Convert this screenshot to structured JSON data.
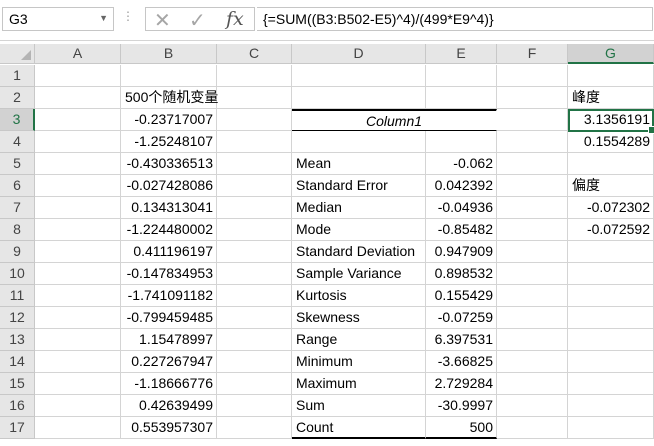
{
  "name_box": {
    "value": "G3"
  },
  "formula_bar": {
    "formula": "{=SUM((B3:B502-E5)^4)/(499*E9^4)}",
    "fx_label": "fx"
  },
  "columns": [
    "A",
    "B",
    "C",
    "D",
    "E",
    "F",
    "G"
  ],
  "rows": [
    "1",
    "2",
    "3",
    "4",
    "5",
    "6",
    "7",
    "8",
    "9",
    "10",
    "11",
    "12",
    "13",
    "14",
    "15",
    "16",
    "17"
  ],
  "cells": {
    "B2": "500个随机变量",
    "B3": "-0.23717007",
    "B4": "-1.25248107",
    "B5": "-0.430336513",
    "B6": "-0.027428086",
    "B7": "0.134313041",
    "B8": "-1.224480002",
    "B9": "0.411196197",
    "B10": "-0.147834953",
    "B11": "-1.741091182",
    "B12": "-0.799459485",
    "B13": "1.15478997",
    "B14": "0.227267947",
    "B15": "-1.18666776",
    "B16": "0.42639499",
    "B17": "0.553957307",
    "D3": "Column1",
    "D5": "Mean",
    "D6": "Standard Error",
    "D7": "Median",
    "D8": "Mode",
    "D9": "Standard Deviation",
    "D10": "Sample Variance",
    "D11": "Kurtosis",
    "D12": "Skewness",
    "D13": "Range",
    "D14": "Minimum",
    "D15": "Maximum",
    "D16": "Sum",
    "D17": "Count",
    "E5": "-0.062",
    "E6": "0.042392",
    "E7": "-0.04936",
    "E8": "-0.85482",
    "E9": "0.947909",
    "E10": "0.898532",
    "E11": "0.155429",
    "E12": "-0.07259",
    "E13": "6.397531",
    "E14": "-3.66825",
    "E15": "2.729284",
    "E16": "-30.9997",
    "E17": "500",
    "G2": "峰度",
    "G3": "3.1356191",
    "G4": "0.1554289",
    "G6": "偏度",
    "G7": "-0.072302",
    "G8": "-0.072592"
  },
  "colors": {
    "accent": "#217346",
    "header_bg": "#e6e6e6",
    "gridline": "#d4d4d4"
  }
}
